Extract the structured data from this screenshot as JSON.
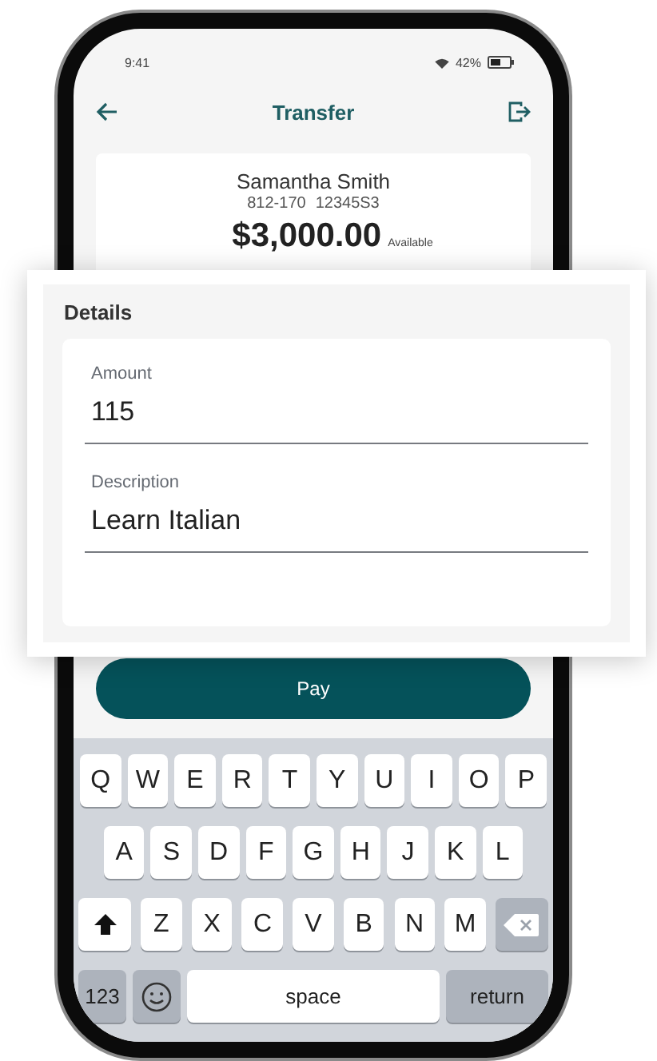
{
  "status_bar": {
    "time": "9:41",
    "battery": "42%"
  },
  "header": {
    "title": "Transfer"
  },
  "account": {
    "name": "Samantha Smith",
    "transit": "812-170",
    "number": "12345S3",
    "balance": "$3,000.00",
    "balance_label": "Available"
  },
  "details": {
    "title": "Details",
    "fields": [
      {
        "label": "Amount",
        "value": "115"
      },
      {
        "label": "Description",
        "value": "Learn Italian"
      }
    ]
  },
  "pay_button": "Pay",
  "keyboard": {
    "rows": [
      [
        {
          "kind": "letter",
          "label": "Q"
        },
        {
          "kind": "letter",
          "label": "W"
        },
        {
          "kind": "letter",
          "label": "E"
        },
        {
          "kind": "letter",
          "label": "R"
        },
        {
          "kind": "letter",
          "label": "T"
        },
        {
          "kind": "letter",
          "label": "Y"
        },
        {
          "kind": "letter",
          "label": "U"
        },
        {
          "kind": "letter",
          "label": "I"
        },
        {
          "kind": "letter",
          "label": "O"
        },
        {
          "kind": "letter",
          "label": "P"
        }
      ],
      [
        {
          "kind": "letter",
          "label": "A"
        },
        {
          "kind": "letter",
          "label": "S"
        },
        {
          "kind": "letter",
          "label": "D"
        },
        {
          "kind": "letter",
          "label": "F"
        },
        {
          "kind": "letter",
          "label": "G"
        },
        {
          "kind": "letter",
          "label": "H"
        },
        {
          "kind": "letter",
          "label": "J"
        },
        {
          "kind": "letter",
          "label": "K"
        },
        {
          "kind": "letter",
          "label": "L"
        }
      ],
      [
        {
          "kind": "shift"
        },
        {
          "kind": "letter",
          "label": "Z"
        },
        {
          "kind": "letter",
          "label": "X"
        },
        {
          "kind": "letter",
          "label": "C"
        },
        {
          "kind": "letter",
          "label": "V"
        },
        {
          "kind": "letter",
          "label": "B"
        },
        {
          "kind": "letter",
          "label": "N"
        },
        {
          "kind": "letter",
          "label": "M"
        },
        {
          "kind": "backspace"
        }
      ]
    ],
    "bottom_keys": {
      "numbers": "123",
      "space": "space",
      "return": "return"
    }
  }
}
